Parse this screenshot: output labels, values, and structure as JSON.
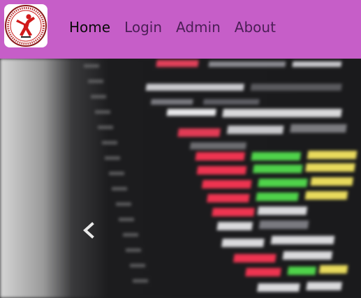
{
  "navbar": {
    "background": "#c65ec8",
    "logo_icon": "university-logo-icon",
    "links": [
      {
        "label": "Home",
        "active": true
      },
      {
        "label": "Login",
        "active": false
      },
      {
        "label": "Admin",
        "active": false
      },
      {
        "label": "About",
        "active": false
      }
    ]
  },
  "carousel": {
    "image": "blurred-code-editor-photo",
    "prev_icon": "chevron-left-icon"
  }
}
